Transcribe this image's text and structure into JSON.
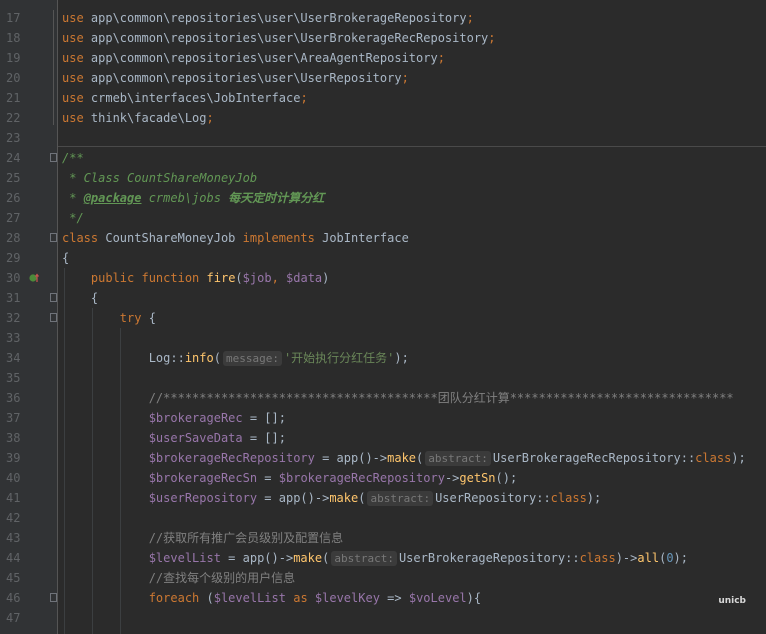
{
  "editor": {
    "lines": [
      {
        "num": "17",
        "segments": [
          {
            "c": "kw",
            "t": "use"
          },
          {
            "c": "txt",
            "t": " app\\common\\repositories\\user\\UserBrokerageRepository"
          },
          {
            "c": "kw",
            "t": ";"
          }
        ]
      },
      {
        "num": "18",
        "segments": [
          {
            "c": "kw",
            "t": "use"
          },
          {
            "c": "txt",
            "t": " app\\common\\repositories\\user\\UserBrokerageRecRepository"
          },
          {
            "c": "kw",
            "t": ";"
          }
        ]
      },
      {
        "num": "19",
        "segments": [
          {
            "c": "kw",
            "t": "use"
          },
          {
            "c": "txt",
            "t": " app\\common\\repositories\\user\\AreaAgentRepository"
          },
          {
            "c": "kw",
            "t": ";"
          }
        ]
      },
      {
        "num": "20",
        "segments": [
          {
            "c": "kw",
            "t": "use"
          },
          {
            "c": "txt",
            "t": " app\\common\\repositories\\user\\UserRepository"
          },
          {
            "c": "kw",
            "t": ";"
          }
        ]
      },
      {
        "num": "21",
        "segments": [
          {
            "c": "kw",
            "t": "use"
          },
          {
            "c": "txt",
            "t": " crmeb\\interfaces\\JobInterface"
          },
          {
            "c": "kw",
            "t": ";"
          }
        ]
      },
      {
        "num": "22",
        "segments": [
          {
            "c": "kw",
            "t": "use"
          },
          {
            "c": "txt",
            "t": " think\\facade\\Log"
          },
          {
            "c": "kw",
            "t": ";"
          }
        ]
      },
      {
        "num": "23",
        "segments": []
      },
      {
        "num": "24",
        "segments": [
          {
            "c": "doc",
            "t": "/**"
          }
        ]
      },
      {
        "num": "25",
        "segments": [
          {
            "c": "doc",
            "t": " * Class CountShareMoneyJob"
          }
        ]
      },
      {
        "num": "26",
        "segments": [
          {
            "c": "doc",
            "t": " * "
          },
          {
            "c": "doctag",
            "t": "@package"
          },
          {
            "c": "doc",
            "t": " crmeb\\jobs "
          },
          {
            "c": "docstrong",
            "t": "每天定时计算分红"
          }
        ]
      },
      {
        "num": "27",
        "segments": [
          {
            "c": "doc",
            "t": " */"
          }
        ]
      },
      {
        "num": "28",
        "segments": [
          {
            "c": "kw",
            "t": "class"
          },
          {
            "c": "txt",
            "t": " CountShareMoneyJob "
          },
          {
            "c": "kw",
            "t": "implements"
          },
          {
            "c": "txt",
            "t": " JobInterface"
          }
        ]
      },
      {
        "num": "29",
        "segments": [
          {
            "c": "txt",
            "t": "{"
          }
        ]
      },
      {
        "num": "30",
        "segments": [
          {
            "c": "txt",
            "t": "    "
          },
          {
            "c": "kw",
            "t": "public function"
          },
          {
            "c": "txt",
            "t": " "
          },
          {
            "c": "fn",
            "t": "fire"
          },
          {
            "c": "txt",
            "t": "("
          },
          {
            "c": "var",
            "t": "$job"
          },
          {
            "c": "kw",
            "t": ","
          },
          {
            "c": "txt",
            "t": " "
          },
          {
            "c": "var",
            "t": "$data"
          },
          {
            "c": "txt",
            "t": ")"
          }
        ]
      },
      {
        "num": "31",
        "segments": [
          {
            "c": "txt",
            "t": "    {"
          }
        ]
      },
      {
        "num": "32",
        "segments": [
          {
            "c": "txt",
            "t": "        "
          },
          {
            "c": "kw",
            "t": "try"
          },
          {
            "c": "txt",
            "t": " {"
          }
        ]
      },
      {
        "num": "33",
        "segments": []
      },
      {
        "num": "34",
        "segments": [
          {
            "c": "txt",
            "t": "            Log::"
          },
          {
            "c": "fn",
            "t": "info"
          },
          {
            "c": "txt",
            "t": "("
          },
          {
            "c": "hint",
            "t": "message:"
          },
          {
            "c": "str",
            "t": "'开始执行分红任务'"
          },
          {
            "c": "txt",
            "t": ");"
          }
        ]
      },
      {
        "num": "35",
        "segments": []
      },
      {
        "num": "36",
        "segments": [
          {
            "c": "txt",
            "t": "            "
          },
          {
            "c": "cmt",
            "t": "//**************************************团队分红计算*******************************"
          }
        ]
      },
      {
        "num": "37",
        "segments": [
          {
            "c": "txt",
            "t": "            "
          },
          {
            "c": "var",
            "t": "$brokerageRec"
          },
          {
            "c": "txt",
            "t": " = [];"
          }
        ]
      },
      {
        "num": "38",
        "segments": [
          {
            "c": "txt",
            "t": "            "
          },
          {
            "c": "var",
            "t": "$userSaveData"
          },
          {
            "c": "txt",
            "t": " = [];"
          }
        ]
      },
      {
        "num": "39",
        "segments": [
          {
            "c": "txt",
            "t": "            "
          },
          {
            "c": "var",
            "t": "$brokerageRecRepository"
          },
          {
            "c": "txt",
            "t": " = app()->"
          },
          {
            "c": "fn",
            "t": "make"
          },
          {
            "c": "txt",
            "t": "("
          },
          {
            "c": "hint",
            "t": "abstract:"
          },
          {
            "c": "txt",
            "t": "UserBrokerageRecRepository::"
          },
          {
            "c": "kw",
            "t": "class"
          },
          {
            "c": "txt",
            "t": ");"
          }
        ]
      },
      {
        "num": "40",
        "segments": [
          {
            "c": "txt",
            "t": "            "
          },
          {
            "c": "var",
            "t": "$brokerageRecSn"
          },
          {
            "c": "txt",
            "t": " = "
          },
          {
            "c": "var",
            "t": "$brokerageRecRepository"
          },
          {
            "c": "txt",
            "t": "->"
          },
          {
            "c": "fn",
            "t": "getSn"
          },
          {
            "c": "txt",
            "t": "();"
          }
        ]
      },
      {
        "num": "41",
        "segments": [
          {
            "c": "txt",
            "t": "            "
          },
          {
            "c": "var",
            "t": "$userRepository"
          },
          {
            "c": "txt",
            "t": " = app()->"
          },
          {
            "c": "fn",
            "t": "make"
          },
          {
            "c": "txt",
            "t": "("
          },
          {
            "c": "hint",
            "t": "abstract:"
          },
          {
            "c": "txt",
            "t": "UserRepository::"
          },
          {
            "c": "kw",
            "t": "class"
          },
          {
            "c": "txt",
            "t": ");"
          }
        ]
      },
      {
        "num": "42",
        "segments": []
      },
      {
        "num": "43",
        "segments": [
          {
            "c": "txt",
            "t": "            "
          },
          {
            "c": "cmt",
            "t": "//获取所有推广会员级别及配置信息"
          }
        ]
      },
      {
        "num": "44",
        "segments": [
          {
            "c": "txt",
            "t": "            "
          },
          {
            "c": "var",
            "t": "$levelList"
          },
          {
            "c": "txt",
            "t": " = app()->"
          },
          {
            "c": "fn",
            "t": "make"
          },
          {
            "c": "txt",
            "t": "("
          },
          {
            "c": "hint",
            "t": "abstract:"
          },
          {
            "c": "txt",
            "t": "UserBrokerageRepository::"
          },
          {
            "c": "kw",
            "t": "class"
          },
          {
            "c": "txt",
            "t": ")->"
          },
          {
            "c": "fn",
            "t": "all"
          },
          {
            "c": "txt",
            "t": "("
          },
          {
            "c": "num",
            "t": "0"
          },
          {
            "c": "txt",
            "t": ");"
          }
        ]
      },
      {
        "num": "45",
        "segments": [
          {
            "c": "txt",
            "t": "            "
          },
          {
            "c": "cmt",
            "t": "//查找每个级别的用户信息"
          }
        ]
      },
      {
        "num": "46",
        "segments": [
          {
            "c": "txt",
            "t": "            "
          },
          {
            "c": "kw",
            "t": "foreach"
          },
          {
            "c": "txt",
            "t": " ("
          },
          {
            "c": "var",
            "t": "$levelList"
          },
          {
            "c": "txt",
            "t": " "
          },
          {
            "c": "kw",
            "t": "as"
          },
          {
            "c": "txt",
            "t": " "
          },
          {
            "c": "var",
            "t": "$levelKey"
          },
          {
            "c": "txt",
            "t": " => "
          },
          {
            "c": "var",
            "t": "$voLevel"
          },
          {
            "c": "txt",
            "t": "){"
          }
        ]
      },
      {
        "num": "47",
        "segments": []
      }
    ]
  },
  "watermark": "unicb"
}
